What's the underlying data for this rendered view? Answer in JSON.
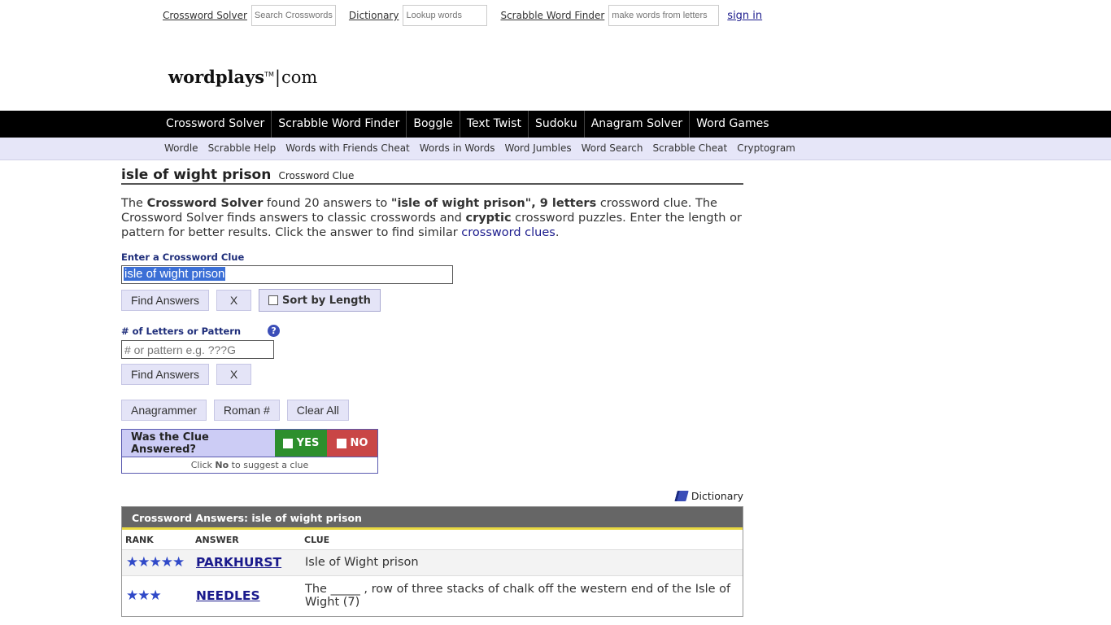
{
  "topbar": {
    "crossword_label": "Crossword Solver",
    "crossword_placeholder": "Search Crosswords",
    "dictionary_label": "Dictionary",
    "dictionary_placeholder": "Lookup words",
    "scrabble_label": "Scrabble Word Finder",
    "scrabble_placeholder": "make words from letters",
    "signin": "sign in"
  },
  "logo": {
    "word": "wordplays",
    "tm": "TM",
    "sep": "|",
    "tld": "com"
  },
  "mainnav": [
    "Crossword Solver",
    "Scrabble Word Finder",
    "Boggle",
    "Text Twist",
    "Sudoku",
    "Anagram Solver",
    "Word Games"
  ],
  "subnav": [
    "Wordle",
    "Scrabble Help",
    "Words with Friends Cheat",
    "Words in Words",
    "Word Jumbles",
    "Word Search",
    "Scrabble Cheat",
    "Cryptogram"
  ],
  "heading": {
    "title": "isle of wight prison",
    "subtitle": "Crossword Clue"
  },
  "intro": {
    "p1": "The ",
    "b1": "Crossword Solver",
    "p2": " found 20 answers to ",
    "b2": "\"isle of wight prison\", 9 letters",
    "p3": " crossword clue. The Crossword Solver finds answers to classic crosswords and ",
    "b3": "cryptic",
    "p4": " crossword puzzles. Enter the length or pattern for better results. Click the answer to find similar ",
    "link": "crossword clues",
    "p5": "."
  },
  "form": {
    "clue_label": "Enter a Crossword Clue",
    "clue_value": "isle of wight prison",
    "find_label": "Find Answers",
    "clear_label": "X",
    "sort_label": "Sort by Length",
    "pattern_label": "# of Letters or Pattern",
    "pattern_placeholder": "# or pattern e.g. ???G",
    "help_glyph": "?",
    "anagram_label": "Anagrammer",
    "roman_label": "Roman #",
    "clear_all_label": "Clear All"
  },
  "answered": {
    "question": "Was the Clue Answered?",
    "yes": "YES",
    "no": "NO",
    "note_pre": "Click ",
    "note_bold": "No",
    "note_post": " to suggest a clue"
  },
  "dictionary_link": "Dictionary",
  "results": {
    "header": "Crossword Answers: isle of wight prison",
    "columns": [
      "RANK",
      "ANSWER",
      "CLUE"
    ],
    "rows": [
      {
        "stars": "★★★★★",
        "answer": "PARKHURST",
        "clue": "Isle of Wight prison"
      },
      {
        "stars": "★★★",
        "answer": "NEEDLES",
        "clue": "The _____ , row of three stacks of chalk off the western end of the Isle of Wight (7)"
      }
    ]
  },
  "colors": {
    "accent": "#1a1a8c",
    "nav_bg": "#000000",
    "subnav_bg": "#e6e6f8",
    "yes": "#2d8f2d",
    "no": "#c94646",
    "stars": "#3049c8"
  }
}
